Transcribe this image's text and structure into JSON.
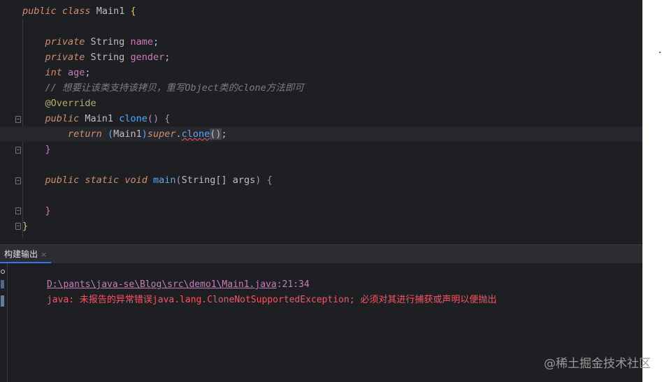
{
  "editor": {
    "lines": [
      {
        "parts": [
          [
            "kwi",
            "public "
          ],
          [
            "kwi",
            "class "
          ],
          [
            "ty",
            "Main1 "
          ],
          [
            "br1",
            "{"
          ]
        ]
      },
      {
        "parts": []
      },
      {
        "parts": [
          [
            "ty",
            "    "
          ],
          [
            "kwi",
            "private "
          ],
          [
            "ty",
            "String "
          ],
          [
            "fld",
            "name"
          ],
          [
            "ty",
            ";"
          ]
        ]
      },
      {
        "parts": [
          [
            "ty",
            "    "
          ],
          [
            "kwi",
            "private "
          ],
          [
            "ty",
            "String "
          ],
          [
            "fld",
            "gender"
          ],
          [
            "ty",
            ";"
          ]
        ]
      },
      {
        "parts": [
          [
            "ty",
            "    "
          ],
          [
            "kwi",
            "int "
          ],
          [
            "fld",
            "age"
          ],
          [
            "ty",
            ";"
          ]
        ]
      },
      {
        "parts": [
          [
            "ty",
            "    "
          ],
          [
            "cm",
            "// 想要让该类支持该拷贝，重写Object类的clone方法即可"
          ]
        ]
      },
      {
        "parts": [
          [
            "ty",
            "    "
          ],
          [
            "an",
            "@Override"
          ]
        ]
      },
      {
        "parts": [
          [
            "ty",
            "    "
          ],
          [
            "kwi",
            "public "
          ],
          [
            "ty",
            "Main1 "
          ],
          [
            "fn",
            "clone"
          ],
          [
            "br2",
            "() "
          ],
          [
            "br2",
            "{"
          ]
        ]
      },
      {
        "parts": [
          [
            "ty",
            "        "
          ],
          [
            "kwi",
            "return "
          ],
          [
            "br3",
            "("
          ],
          [
            "ty",
            "Main1"
          ],
          [
            "br3",
            ")"
          ],
          [
            "sup",
            "super"
          ],
          [
            "ty",
            "."
          ],
          [
            "fn err",
            "clone"
          ],
          [
            "paren",
            "()"
          ],
          [
            "ty",
            ";"
          ]
        ]
      },
      {
        "parts": [
          [
            "ty",
            "    "
          ],
          [
            "br2",
            "}"
          ]
        ]
      },
      {
        "parts": []
      },
      {
        "parts": [
          [
            "ty",
            "    "
          ],
          [
            "kwi",
            "public "
          ],
          [
            "kwi",
            "static "
          ],
          [
            "kwi",
            "void "
          ],
          [
            "fn",
            "main"
          ],
          [
            "br2",
            "("
          ],
          [
            "ty",
            "String[] "
          ],
          [
            "ty",
            "args"
          ],
          [
            "br2",
            ") "
          ],
          [
            "br2",
            "{"
          ]
        ]
      },
      {
        "parts": []
      },
      {
        "parts": [
          [
            "ty",
            "    "
          ],
          [
            "br2",
            "}"
          ]
        ]
      },
      {
        "parts": [
          [
            "br1",
            "}"
          ]
        ]
      }
    ]
  },
  "tool_window": {
    "tab_label": "构建输出",
    "close_glyph": "×",
    "error_path": "D:\\pants\\java-se\\Blog\\src\\demo1\\Main1.java",
    "error_position": ":21:34",
    "error_message": "java: 未报告的异常错误java.lang.CloneNotSupportedException; 必须对其进行捕获或声明以便抛出"
  },
  "watermark": "@稀土掘金技术社区"
}
